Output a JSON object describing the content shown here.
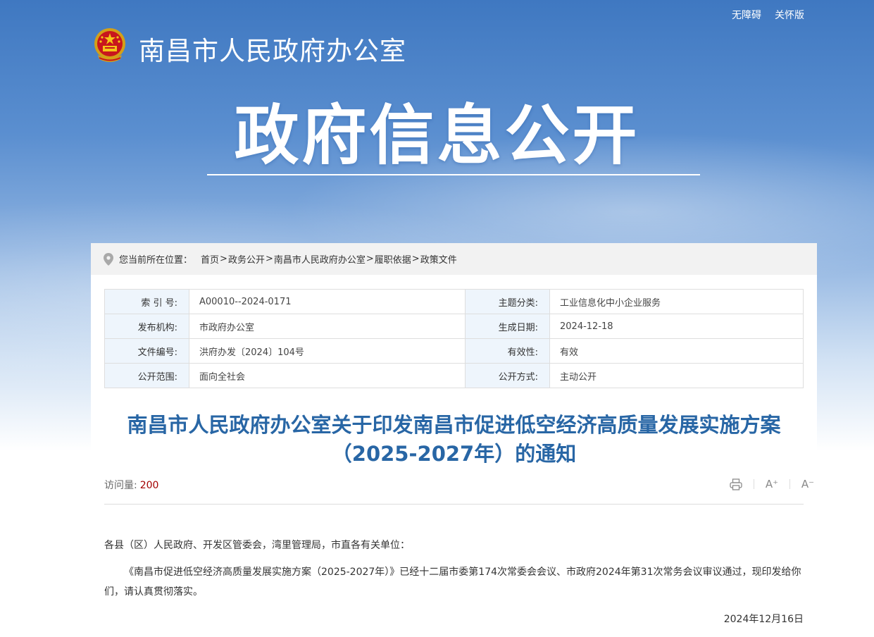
{
  "header": {
    "top_links": [
      "无障碍",
      "关怀版"
    ],
    "site_title": "南昌市人民政府办公室",
    "hero_title": "政府信息公开"
  },
  "breadcrumb": {
    "label": "您当前所在位置：",
    "items": [
      "首页",
      "政务公开",
      "南昌市人民政府办公室",
      "履职依据",
      "政策文件"
    ],
    "separator": ">"
  },
  "meta": {
    "rows": [
      {
        "k1": "索 引 号:",
        "v1": "A00010--2024-0171",
        "k2": "主题分类:",
        "v2": "工业信息化中小企业服务"
      },
      {
        "k1": "发布机构:",
        "v1": "市政府办公室",
        "k2": "生成日期:",
        "v2": "2024-12-18"
      },
      {
        "k1": "文件编号:",
        "v1": "洪府办发〔2024〕104号",
        "k2": "有效性:",
        "v2": "有效"
      },
      {
        "k1": "公开范围:",
        "v1": "面向全社会",
        "k2": "公开方式:",
        "v2": "主动公开"
      }
    ]
  },
  "article": {
    "title": "南昌市人民政府办公室关于印发南昌市促进低空经济高质量发展实施方案（2025-2027年）的通知",
    "visits_label": "访问量:",
    "visits_count": "200",
    "tools": {
      "print": "print-icon",
      "font_up": "A⁺",
      "font_down": "A⁻"
    },
    "salutation": "各县（区）人民政府、开发区管委会，湾里管理局，市直各有关单位：",
    "paragraph": "《南昌市促进低空经济高质量发展实施方案（2025-2027年）》已经十二届市委第174次常委会会议、市政府2024年第31次常务会议审议通过，现印发给你们，请认真贯彻落实。",
    "date": "2024年12月16日"
  },
  "colors": {
    "banner_top": "#3f78c1",
    "title_blue": "#2866a5",
    "visits_red": "#a30000",
    "meta_key_bg": "#eef5fc"
  }
}
